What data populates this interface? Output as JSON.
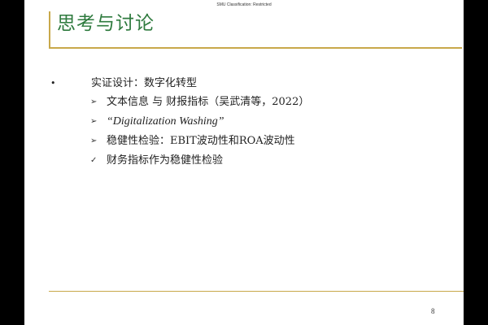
{
  "header": {
    "classification": "SMU Classification: Restricted"
  },
  "slide": {
    "title": "思考与讨论",
    "main_bullet": {
      "marker": "•",
      "text": "实证设计：数字化转型"
    },
    "sub_items": [
      {
        "marker": "➢",
        "text": "文本信息 与 财报指标（吴武清等，2022）",
        "italic": false
      },
      {
        "marker": "➢",
        "text": "“Digitalization Washing”",
        "italic": true
      },
      {
        "marker": "➢",
        "text": "稳健性检验：EBIT波动性和ROA波动性",
        "italic": false
      },
      {
        "marker": "✓",
        "text": "财务指标作为稳健性检验",
        "italic": false
      }
    ],
    "page_number": "8"
  },
  "colors": {
    "title": "#2e7a3e",
    "accent_line": "#c8a84a",
    "letterbox": "#000000"
  }
}
